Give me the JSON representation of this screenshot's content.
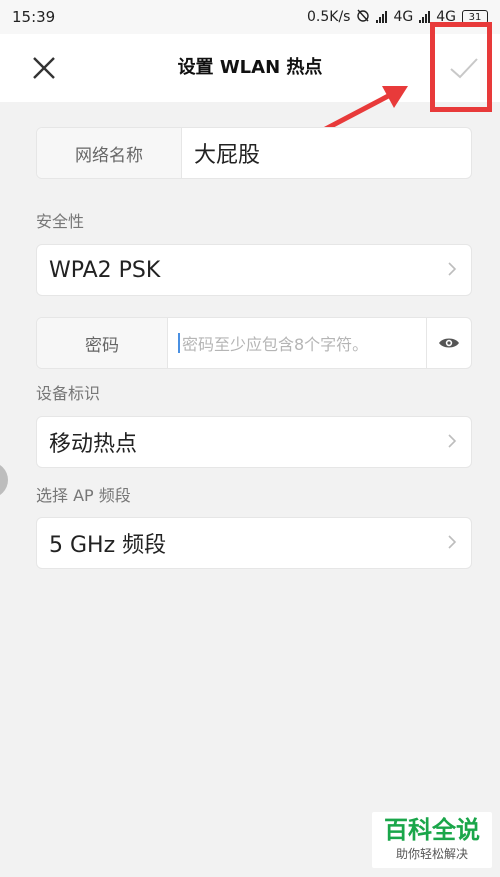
{
  "status_bar": {
    "time": "15:39",
    "speed": "0.5K/s",
    "network1": "4G",
    "network2": "4G",
    "battery": "31"
  },
  "header": {
    "title": "设置 WLAN 热点"
  },
  "network_name": {
    "label": "网络名称",
    "value": "大屁股"
  },
  "security": {
    "section_label": "安全性",
    "value": "WPA2 PSK"
  },
  "password": {
    "label": "密码",
    "placeholder": "密码至少应包含8个字符。"
  },
  "device_id": {
    "section_label": "设备标识",
    "value": "移动热点"
  },
  "ap_band": {
    "section_label": "选择 AP 频段",
    "value": "5 GHz 频段"
  },
  "watermark": {
    "main": "百科全说",
    "sub": "助你轻松解决"
  },
  "colors": {
    "annotation_red": "#e83a3a",
    "watermark_green": "#1aa64a",
    "cursor_blue": "#4a90e2"
  },
  "icons": [
    "close-icon",
    "check-icon",
    "chevron-right-icon",
    "eye-icon",
    "signal-icon",
    "battery-icon",
    "alarm-off-icon"
  ]
}
